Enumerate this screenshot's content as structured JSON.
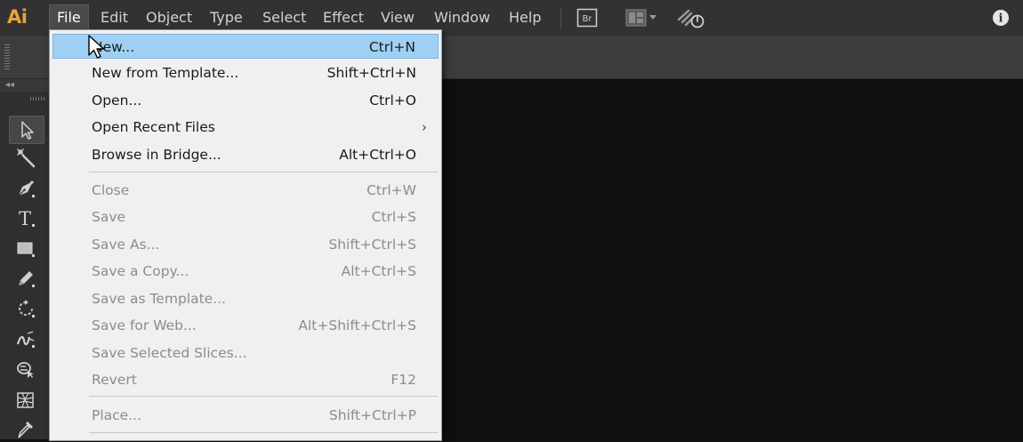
{
  "app": {
    "logo": "Ai"
  },
  "menubar": {
    "items": [
      {
        "label": "File"
      },
      {
        "label": "Edit"
      },
      {
        "label": "Object"
      },
      {
        "label": "Type"
      },
      {
        "label": "Select"
      },
      {
        "label": "Effect"
      },
      {
        "label": "View"
      },
      {
        "label": "Window"
      },
      {
        "label": "Help"
      }
    ],
    "icons": [
      "bridge-icon",
      "arrange-documents-icon",
      "gpu-performance-icon",
      "info-icon"
    ],
    "bridge_label": "Br",
    "info_label": "i"
  },
  "file_menu": {
    "items": [
      {
        "label": "New...",
        "shortcut": "Ctrl+N",
        "enabled": true,
        "highlighted": true
      },
      {
        "label": "New from Template...",
        "shortcut": "Shift+Ctrl+N",
        "enabled": true
      },
      {
        "label": "Open...",
        "shortcut": "Ctrl+O",
        "enabled": true
      },
      {
        "label": "Open Recent Files",
        "shortcut": "",
        "enabled": true,
        "submenu": true,
        "arrow": "›"
      },
      {
        "label": "Browse in Bridge...",
        "shortcut": "Alt+Ctrl+O",
        "enabled": true
      },
      {
        "label": "Close",
        "shortcut": "Ctrl+W",
        "enabled": false
      },
      {
        "label": "Save",
        "shortcut": "Ctrl+S",
        "enabled": false
      },
      {
        "label": "Save As...",
        "shortcut": "Shift+Ctrl+S",
        "enabled": false
      },
      {
        "label": "Save a Copy...",
        "shortcut": "Alt+Ctrl+S",
        "enabled": false
      },
      {
        "label": "Save as Template...",
        "shortcut": "",
        "enabled": false
      },
      {
        "label": "Save for Web...",
        "shortcut": "Alt+Shift+Ctrl+S",
        "enabled": false
      },
      {
        "label": "Save Selected Slices...",
        "shortcut": "",
        "enabled": false
      },
      {
        "label": "Revert",
        "shortcut": "F12",
        "enabled": false
      },
      {
        "label": "Place...",
        "shortcut": "Shift+Ctrl+P",
        "enabled": false
      }
    ]
  },
  "toolbar": {
    "collapse_glyph": "◂◂",
    "tools": [
      "selection-tool",
      "magic-wand-tool",
      "pen-tool",
      "type-tool",
      "rectangle-tool",
      "pencil-tool",
      "rotate-tool",
      "width-tool",
      "shape-builder-tool",
      "perspective-grid-tool",
      "eyedropper-tool"
    ],
    "type_tool_glyph": "T"
  },
  "colors": {
    "menubar_bg": "#323232",
    "canvas_bg": "#0f0f0f",
    "highlight": "#9fcff2",
    "logo": "#e8a33a"
  }
}
